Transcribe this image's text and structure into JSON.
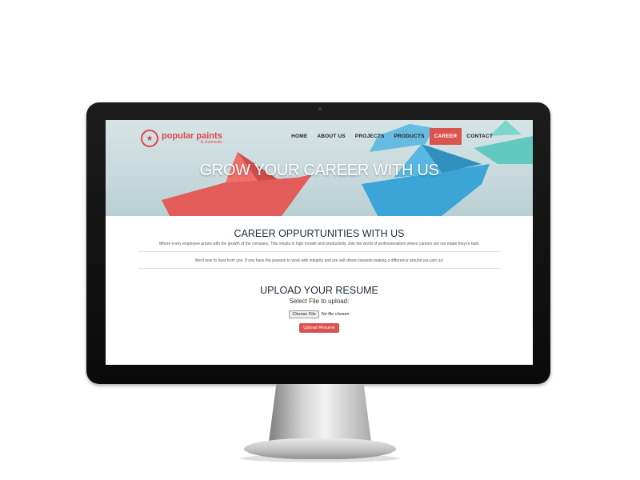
{
  "site": {
    "logo": {
      "name": "popular paints",
      "subname": "& chemicals",
      "icon": "rooster-icon",
      "color": "#e0464a"
    },
    "nav": [
      {
        "label": "HOME",
        "active": false
      },
      {
        "label": "ABOUT US",
        "active": false
      },
      {
        "label": "PROJECTS",
        "active": false
      },
      {
        "label": "PRODUCTS",
        "active": false
      },
      {
        "label": "CAREER",
        "active": true
      },
      {
        "label": "CONTACT",
        "active": false
      }
    ],
    "hero_title": "GROW YOUR CAREER WITH US"
  },
  "career": {
    "title": "CAREER OPPURTUNITIES WITH US",
    "description": "Where every employee grows with the growth of the company. This results in high morale and productivity. Join the world of professionalism where careers are not made they're built.",
    "note": "We'd love to hear from you. If you have the passion to work with integrity and are self driven towards making a difference around you join us!"
  },
  "upload": {
    "title": "UPLOAD YOUR RESUME",
    "label": "Select File to upload:",
    "choose_button": "Choose File",
    "file_status": "No file chosen",
    "submit_button": "Upload Resume"
  },
  "colors": {
    "accent": "#d9534f",
    "heading": "#1f2c3a"
  }
}
